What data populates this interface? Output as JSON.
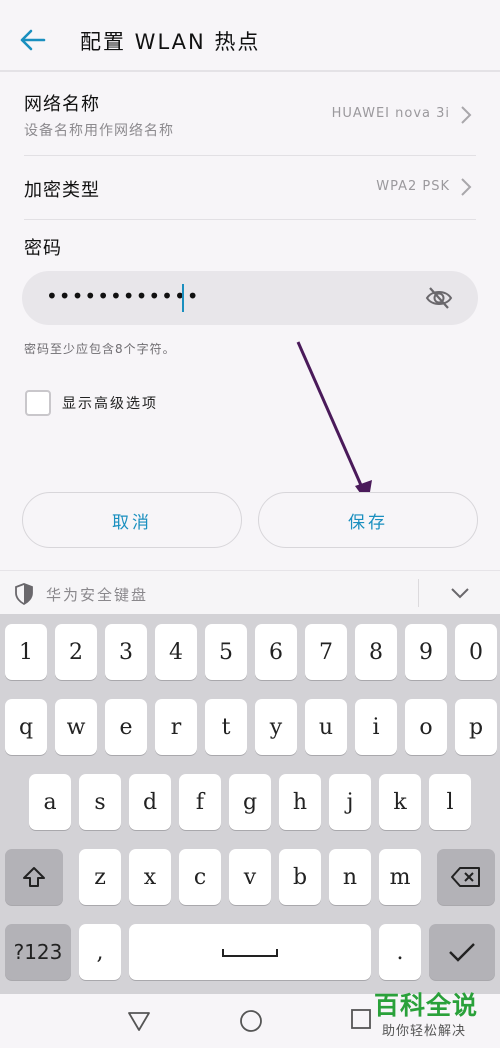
{
  "header": {
    "title": "配置 WLAN 热点",
    "back_icon": "back-arrow-icon"
  },
  "network_name": {
    "label": "网络名称",
    "sublabel": "设备名称用作网络名称",
    "value": "HUAWEI nova 3i"
  },
  "encryption": {
    "label": "加密类型",
    "value": "WPA2 PSK"
  },
  "password": {
    "label": "密码",
    "value": "••••••••••••",
    "hint": "密码至少应包含8个字符。",
    "visibility_icon": "eye-off-icon"
  },
  "advanced": {
    "label": "显示高级选项",
    "checked": false
  },
  "buttons": {
    "cancel": "取消",
    "save": "保存"
  },
  "keyboard": {
    "title": "华为安全键盘",
    "row1": [
      "1",
      "2",
      "3",
      "4",
      "5",
      "6",
      "7",
      "8",
      "9",
      "0"
    ],
    "row2": [
      "q",
      "w",
      "e",
      "r",
      "t",
      "y",
      "u",
      "i",
      "o",
      "p"
    ],
    "row3": [
      "a",
      "s",
      "d",
      "f",
      "g",
      "h",
      "j",
      "k",
      "l"
    ],
    "row4": [
      "z",
      "x",
      "c",
      "v",
      "b",
      "n",
      "m"
    ],
    "symbols_key": "?123",
    "comma_key": ",",
    "period_key": "."
  },
  "watermark": {
    "title": "百科全说",
    "subtitle": "助你轻松解决"
  },
  "colors": {
    "accent": "#1a8fbf",
    "annotation_arrow": "#4a1a5a",
    "keyboard_bg": "#d3d2d6"
  }
}
